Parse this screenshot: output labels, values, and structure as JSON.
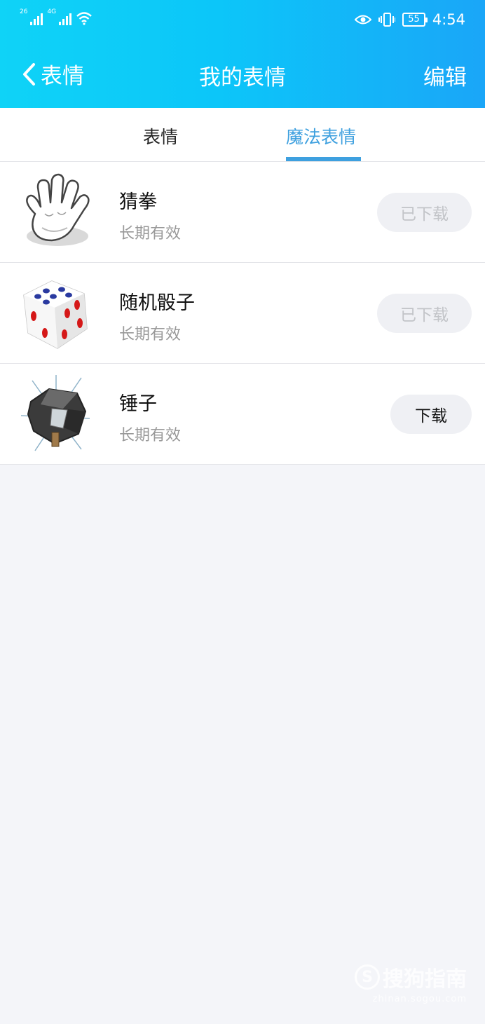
{
  "status_bar": {
    "network1": "26",
    "network2": "4G",
    "battery": "55",
    "time": "4:54"
  },
  "header": {
    "back_label": "表情",
    "title": "我的表情",
    "edit_label": "编辑"
  },
  "tabs": [
    {
      "label": "表情",
      "active": false
    },
    {
      "label": "魔法表情",
      "active": true
    }
  ],
  "items": [
    {
      "icon": "glove-hand-icon",
      "name": "猜拳",
      "validity": "长期有效",
      "button": "已下载",
      "downloaded": true
    },
    {
      "icon": "dice-icon",
      "name": "随机骰子",
      "validity": "长期有效",
      "button": "已下载",
      "downloaded": true
    },
    {
      "icon": "hammer-smash-icon",
      "name": "锤子",
      "validity": "长期有效",
      "button": "下载",
      "downloaded": false
    }
  ],
  "watermark": {
    "logo_letter": "S",
    "text": "搜狗指南",
    "url": "zhinan.sogou.com"
  },
  "colors": {
    "header_start": "#0fd3f7",
    "header_end": "#1aa6f8",
    "accent": "#3ea0df",
    "background": "#f4f5f9"
  }
}
